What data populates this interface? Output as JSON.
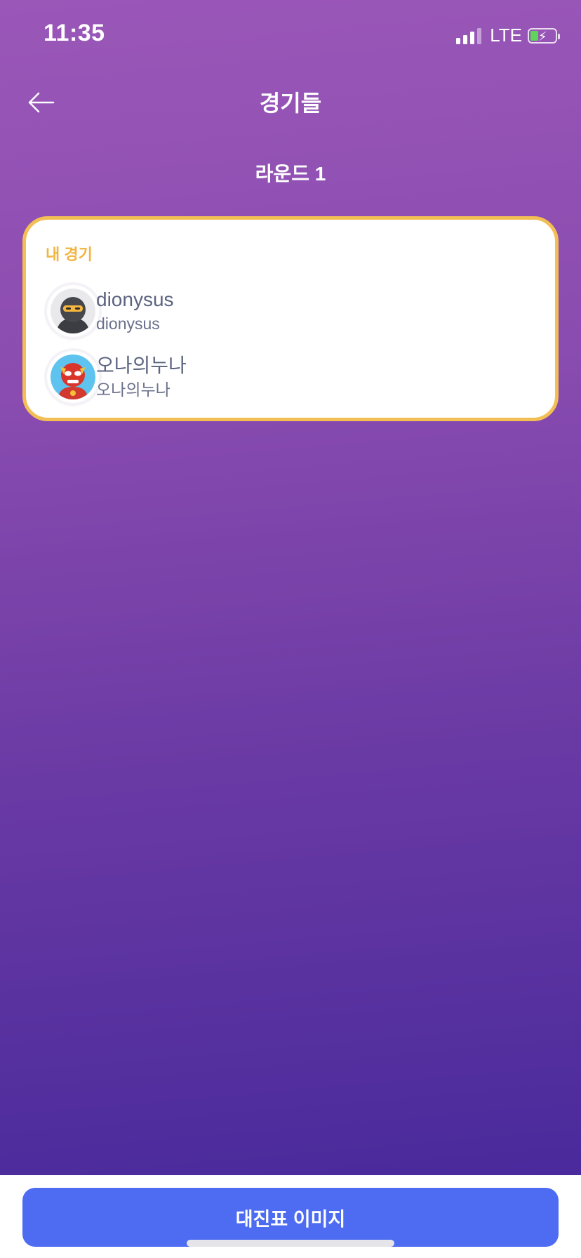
{
  "status_bar": {
    "time": "11:35",
    "network": "LTE",
    "signal_bars": 3,
    "battery_level": 0.35,
    "battery_charging": true
  },
  "header": {
    "title": "경기들",
    "back_icon": "arrow-left-icon"
  },
  "round": {
    "label": "라운드 1"
  },
  "match_card": {
    "label": "내 경기",
    "highlight_color": "#f3bf55",
    "players": [
      {
        "name": "dionysus",
        "id": "dionysus",
        "avatar": "ninja-avatar"
      },
      {
        "name": "오나의누나",
        "id": "오나의누나",
        "avatar": "red-masked-hero-avatar"
      }
    ]
  },
  "bottom": {
    "button_label": "대진표 이미지",
    "button_color": "#4d6cf2"
  },
  "colors": {
    "gradient_top": "#9a57b8",
    "gradient_bottom": "#43279a",
    "label_accent": "#f3b440"
  }
}
